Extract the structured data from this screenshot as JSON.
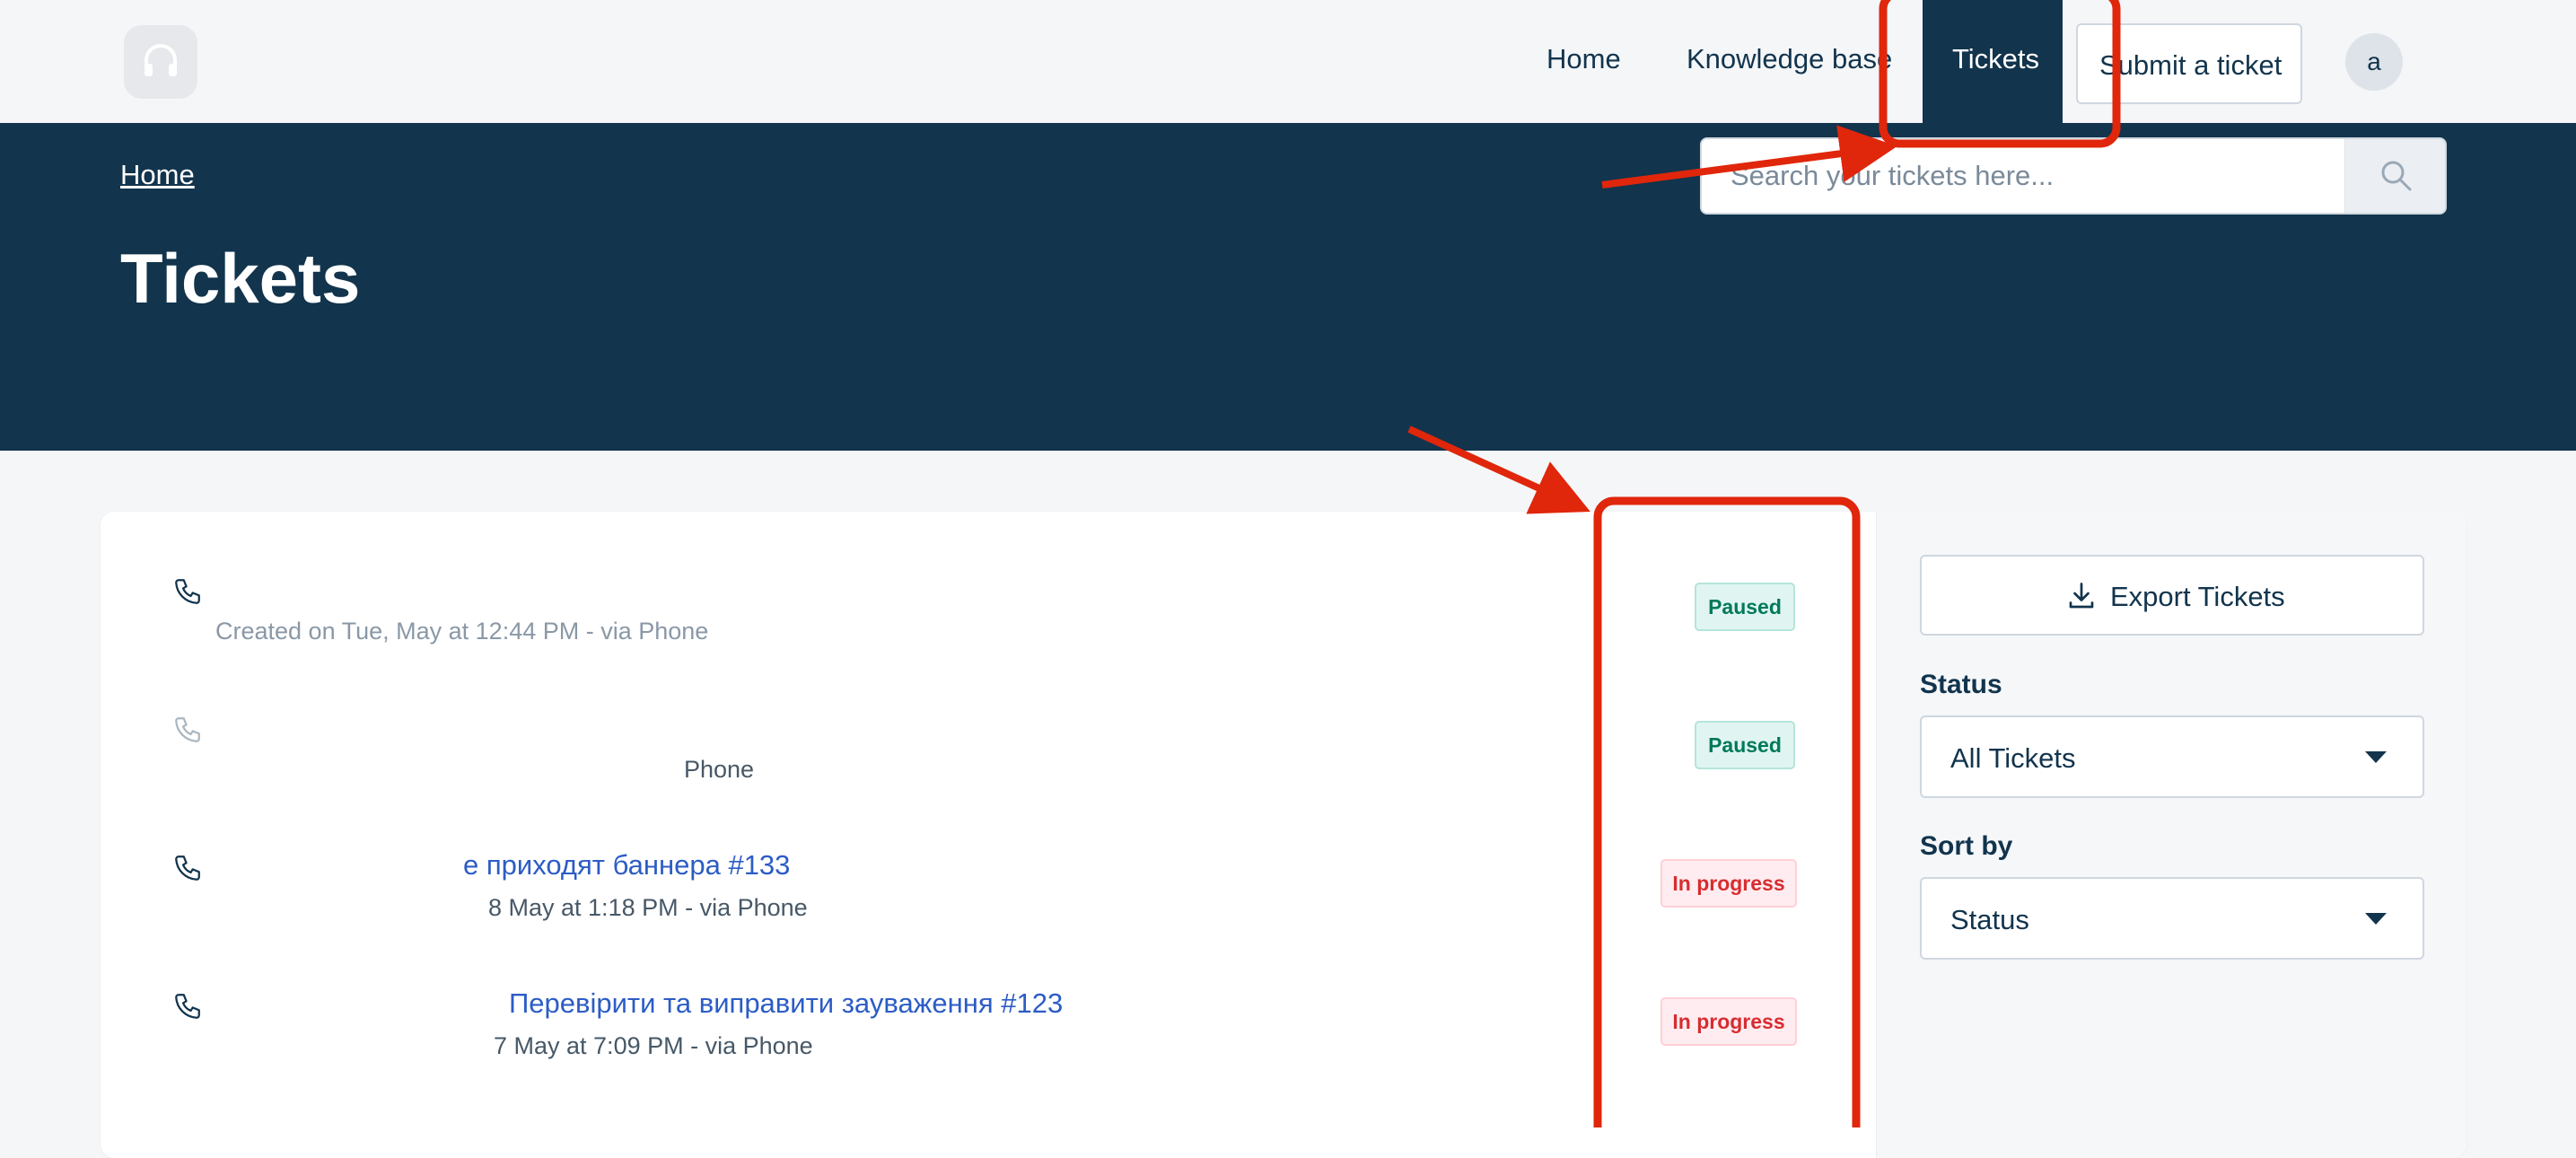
{
  "nav": {
    "home": "Home",
    "knowledge_base": "Knowledge base",
    "tickets": "Tickets",
    "submit_ticket": "Submit a ticket",
    "avatar_initial": "a"
  },
  "hero": {
    "breadcrumb": "Home",
    "title": "Tickets",
    "search_placeholder": "Search your tickets here..."
  },
  "tickets": [
    {
      "title": "",
      "meta": "Created on Tue, May at 12:44 PM - via Phone",
      "status": "Paused"
    },
    {
      "title": "",
      "meta": "Phone",
      "status": "Paused"
    },
    {
      "title": "е приходят баннера #133",
      "meta": "8 May at 1:18 PM - via Phone",
      "status": "In progress"
    },
    {
      "title": "Перевірити та виправити зауваження #123",
      "meta": "7 May at 7:09 PM - via Phone",
      "status": "In progress"
    }
  ],
  "sidebar": {
    "export_label": "Export Tickets",
    "status_label": "Status",
    "status_value": "All Tickets",
    "sort_label": "Sort by",
    "sort_value": "Status"
  },
  "colors": {
    "brand_navy": "#12344d",
    "link_blue": "#2c5cc5",
    "paused_green": "#00795b",
    "in_progress_red": "#d72d30",
    "annotation_red": "#e0260b"
  },
  "icons": {
    "logo": "headset-icon",
    "search": "search-icon",
    "ticket_source": "phone-icon",
    "export": "download-icon",
    "dropdown": "caret-down-icon"
  }
}
